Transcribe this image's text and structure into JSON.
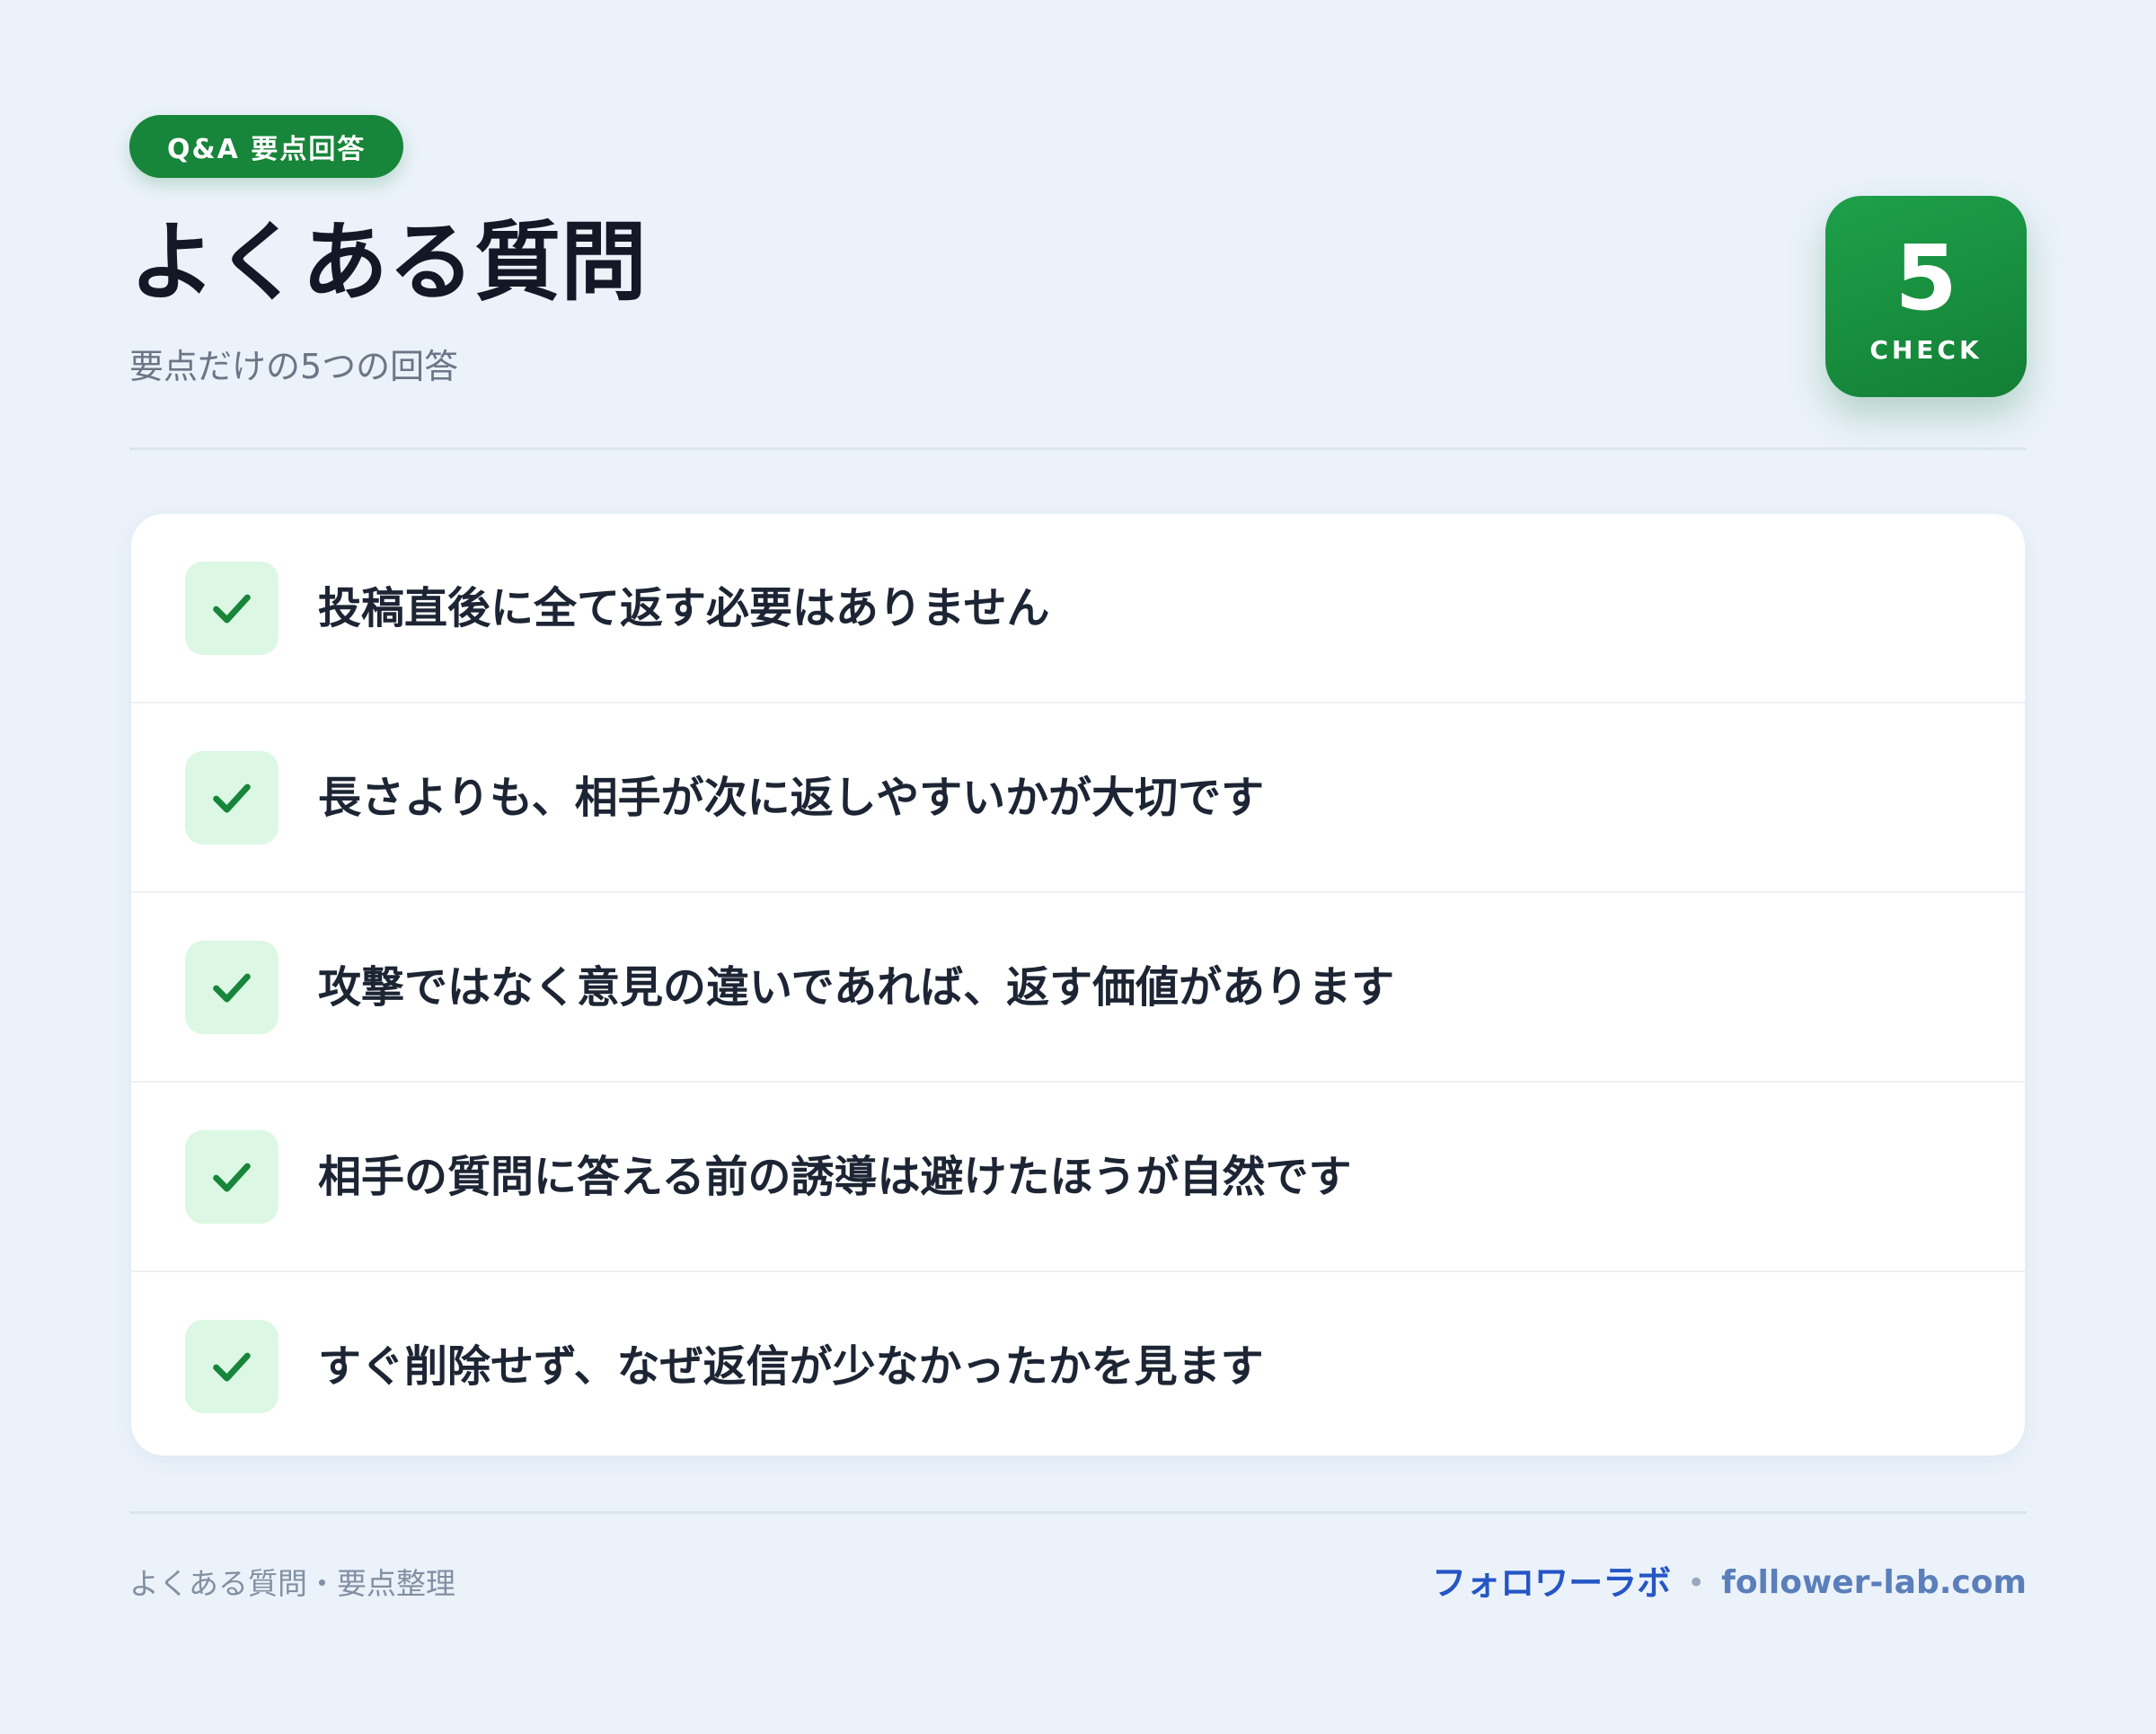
{
  "header": {
    "badge": "Q&A 要点回答",
    "title": "よくある質問",
    "subtitle": "要点だけの5つの回答"
  },
  "count_card": {
    "number": "5",
    "label": "CHECK"
  },
  "items": [
    {
      "text": "投稿直後に全て返す必要はありません"
    },
    {
      "text": "長さよりも、相手が次に返しやすいかが大切です"
    },
    {
      "text": "攻撃ではなく意見の違いであれば、返す価値があります"
    },
    {
      "text": "相手の質問に答える前の誘導は避けたほうが自然です"
    },
    {
      "text": "すぐ削除せず、なぜ返信が少なかったかを見ます"
    }
  ],
  "footer": {
    "left": "よくある質問・要点整理",
    "brand": "フォロワーラボ",
    "separator": "•",
    "domain": "follower-lab.com"
  },
  "colors": {
    "background": "#ebf2fa",
    "accent_green": "#17853a",
    "check_bg": "#dcf8e4",
    "brand_blue": "#2556c5"
  },
  "icons": {
    "check": "check-icon"
  }
}
